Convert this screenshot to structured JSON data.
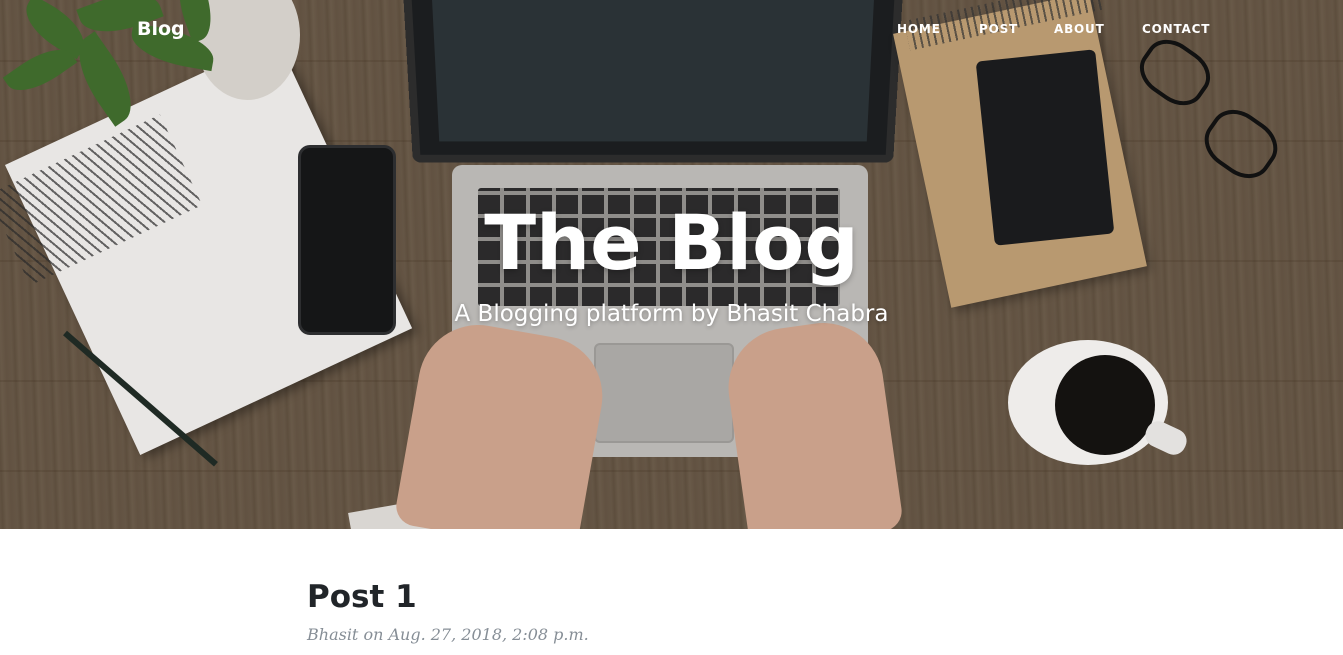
{
  "nav": {
    "brand": "Blog",
    "items": [
      {
        "label": "HOME"
      },
      {
        "label": "POST"
      },
      {
        "label": "ABOUT"
      },
      {
        "label": "CONTACT"
      }
    ]
  },
  "hero": {
    "title": "The Blog",
    "subtitle": "A Blogging platform by Bhasit Chabra"
  },
  "posts": [
    {
      "title": "Post 1",
      "meta": "Bhasit on Aug. 27, 2018, 2:08 p.m."
    }
  ]
}
